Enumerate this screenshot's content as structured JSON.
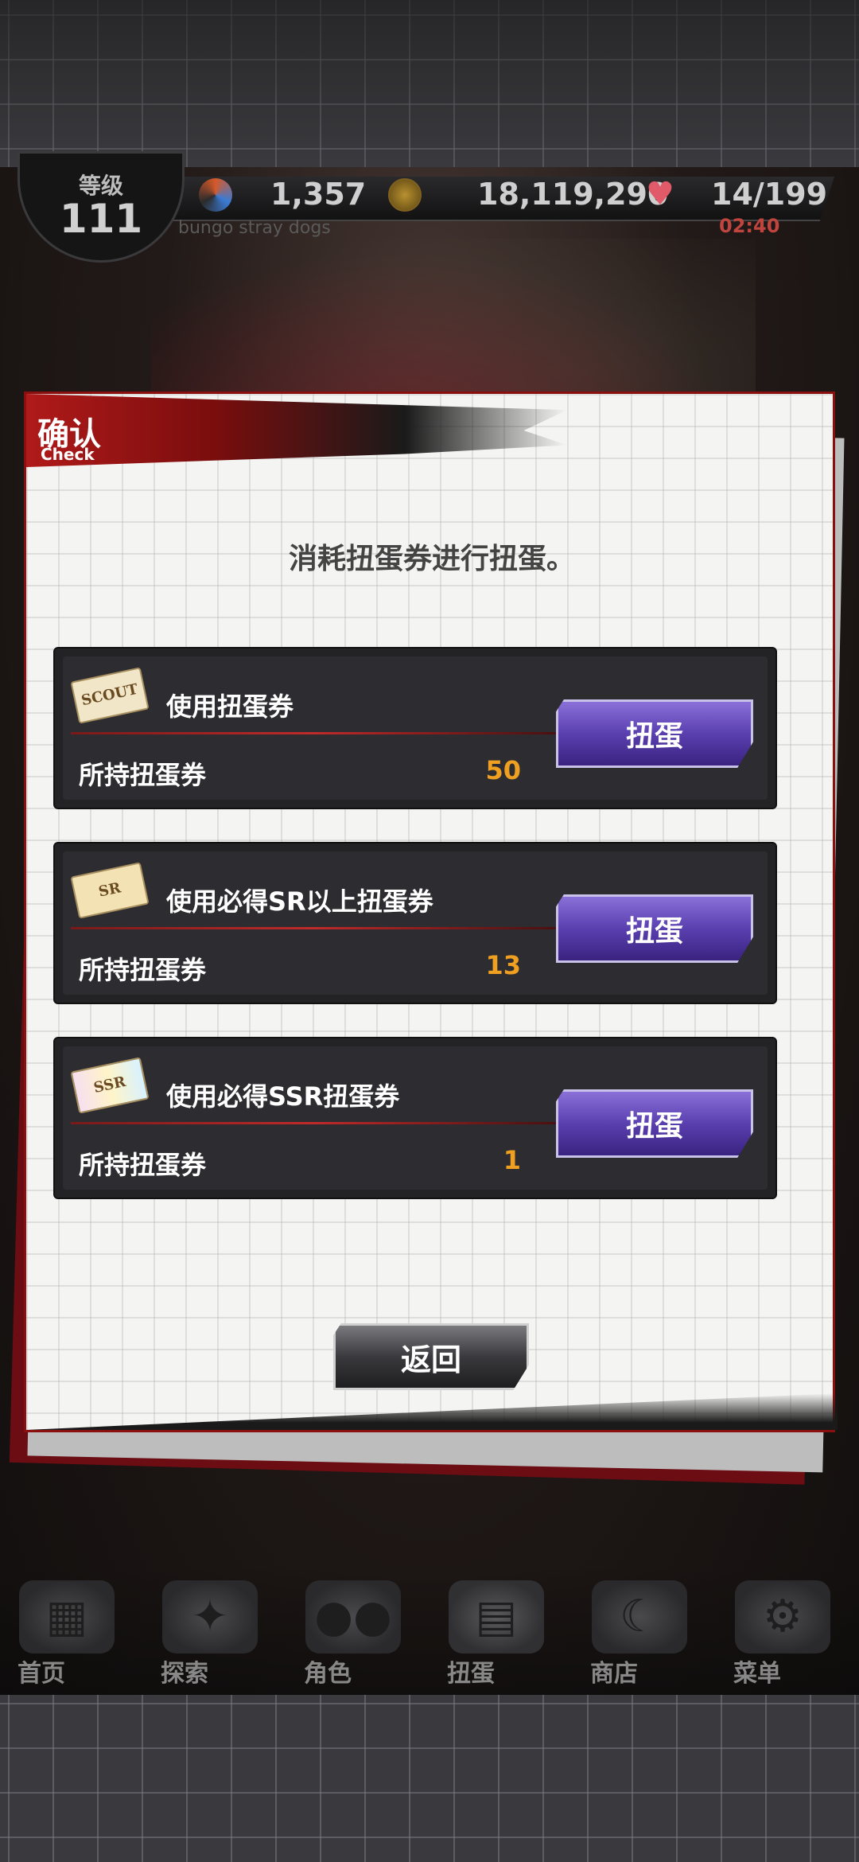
{
  "hud": {
    "level_label": "等级",
    "level": "111",
    "stones": "1,357",
    "coins": "18,119,290",
    "stamina": "14/199",
    "timer": "02:40",
    "game_name": "bungo stray dogs",
    "icons": {
      "stone": "stone-icon",
      "coin": "coin-icon",
      "heart": "heart-icon"
    }
  },
  "dialog": {
    "title": "确认",
    "subtitle": "Check",
    "message": "消耗扭蛋券进行扭蛋。",
    "tickets": [
      {
        "icon_text": "SCOUT",
        "name": "使用扭蛋券",
        "owned_label": "所持扭蛋券",
        "owned_count": "50",
        "button_label": "扭蛋"
      },
      {
        "icon_text": "SR",
        "name": "使用必得SR以上扭蛋券",
        "owned_label": "所持扭蛋券",
        "owned_count": "13",
        "button_label": "扭蛋"
      },
      {
        "icon_text": "SSR",
        "name": "使用必得SSR扭蛋券",
        "owned_label": "所持扭蛋券",
        "owned_count": "1",
        "button_label": "扭蛋"
      }
    ],
    "back_label": "返回"
  },
  "nav": {
    "items": [
      {
        "label": "首页",
        "icon": "home-icon"
      },
      {
        "label": "探索",
        "icon": "explore-icon"
      },
      {
        "label": "角色",
        "icon": "characters-icon"
      },
      {
        "label": "扭蛋",
        "icon": "gacha-icon"
      },
      {
        "label": "商店",
        "icon": "shop-icon"
      },
      {
        "label": "菜单",
        "icon": "menu-gear-icon"
      }
    ]
  },
  "colors": {
    "accent_red": "#b01a1a",
    "gacha_purple": "#5a3fb0",
    "count_orange": "#f0a020"
  }
}
